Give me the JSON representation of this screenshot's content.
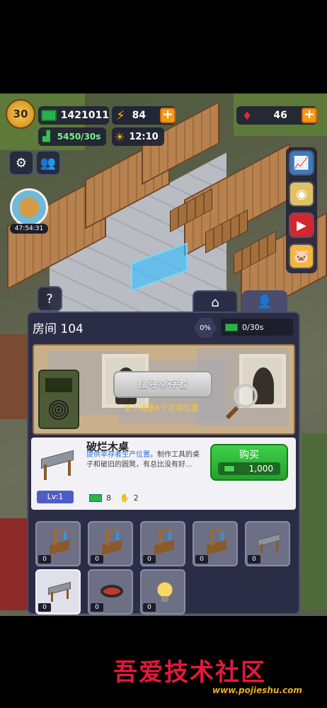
{
  "hud": {
    "level": "30",
    "cash": "1421011",
    "energy": "84",
    "gems": "46",
    "income": "5450/30s",
    "clock": "12:10"
  },
  "survivor_timer": "47:54:31",
  "help_label": "?",
  "room": {
    "title": "房间 104",
    "progress": "0%",
    "production": "0/30s"
  },
  "board": {
    "search_button": "搜寻幸存者",
    "hint": "至少需要6个可用位置"
  },
  "item": {
    "name": "破烂木桌",
    "desc_highlight": "提供幸存者生产位置",
    "desc_rest": "。制作工具的桌子和破旧的圆凳，有总比没有好...",
    "buy_label": "购买",
    "price": "1,000",
    "level": "Lv:1",
    "stat_cash": "8",
    "stat_hands": "2"
  },
  "slots": [
    {
      "count": "0",
      "icon": "workbench-crane-icon"
    },
    {
      "count": "0",
      "icon": "workbench-crane-icon"
    },
    {
      "count": "0",
      "icon": "workbench-crane-icon"
    },
    {
      "count": "0",
      "icon": "workbench-crane-icon"
    },
    {
      "count": "0",
      "icon": "broken-table-icon"
    },
    {
      "count": "0",
      "icon": "broken-table-icon"
    },
    {
      "count": "0",
      "icon": "bear-trap-icon"
    },
    {
      "count": "0",
      "icon": "light-bulb-icon"
    }
  ],
  "watermark": {
    "text": "吾爱技术社区",
    "url": "www.pojieshu.com"
  },
  "colors": {
    "panel": "#2b2d47",
    "accent_orange": "#f39a1d",
    "buy_green": "#2fb83a",
    "cash_green": "#2bb24c",
    "watermark_red": "#e6183a"
  }
}
